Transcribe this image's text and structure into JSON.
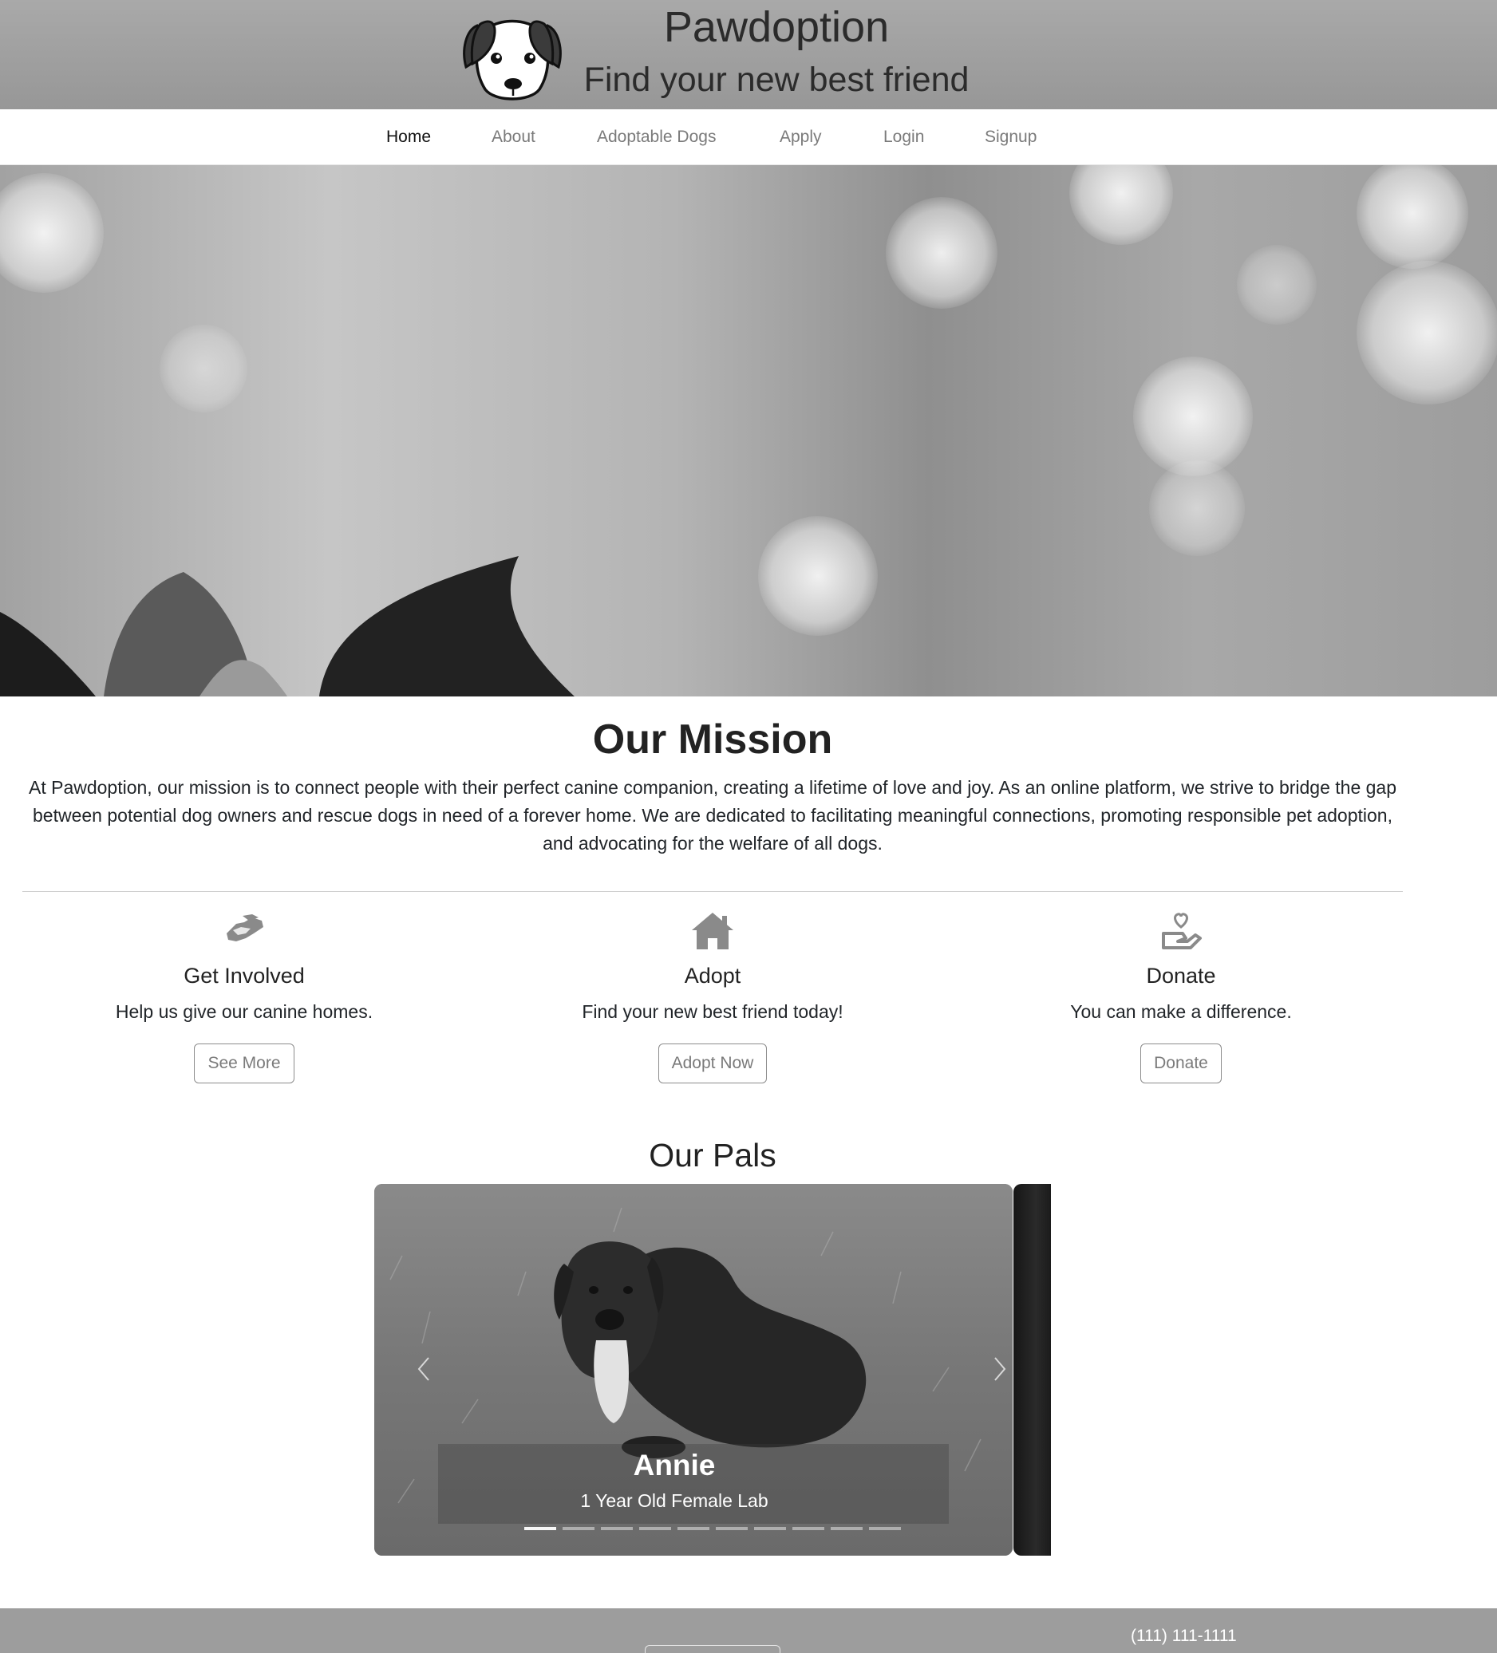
{
  "header": {
    "brand_title": "Pawdoption",
    "tagline": "Find your new best friend",
    "logo_icon": "dog-face-icon"
  },
  "nav": {
    "items": [
      {
        "label": "Home",
        "active": true
      },
      {
        "label": "About",
        "active": false
      },
      {
        "label": "Adoptable Dogs",
        "active": false
      },
      {
        "label": "Apply",
        "active": false
      },
      {
        "label": "Login",
        "active": false
      },
      {
        "label": "Signup",
        "active": false
      }
    ]
  },
  "mission": {
    "title": "Our Mission",
    "text": "At Pawdoption, our mission is to connect people with their perfect canine companion, creating a lifetime of love and joy. As an online platform, we strive to bridge the gap between potential dog owners and rescue dogs in need of a forever home. We are dedicated to facilitating meaningful connections, promoting responsible pet adoption, and advocating for the welfare of all dogs."
  },
  "features": [
    {
      "icon": "handshake-icon",
      "title": "Get Involved",
      "text": "Help us give our canine homes.",
      "button": "See More"
    },
    {
      "icon": "house-icon",
      "title": "Adopt",
      "text": "Find your new best friend today!",
      "button": "Adopt Now"
    },
    {
      "icon": "hand-holding-heart-icon",
      "title": "Donate",
      "text": "You can make a difference.",
      "button": "Donate"
    }
  ],
  "pals": {
    "title": "Our Pals",
    "current_slide": {
      "name": "Annie",
      "description": "1 Year Old Female Lab"
    },
    "indicator_count": 10,
    "active_indicator": 1
  },
  "footer": {
    "phone": "(111) 111-1111"
  },
  "colors": {
    "header_bg": "#a0a0a0",
    "footer_bg": "#9d9d9d",
    "text_dark": "#212529",
    "nav_muted": "#7a7a7a"
  }
}
